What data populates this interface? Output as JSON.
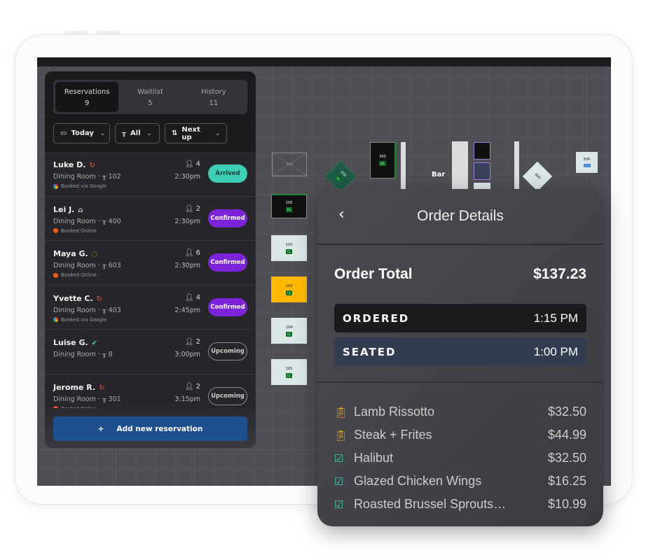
{
  "tabs": [
    {
      "label": "Reservations",
      "count": "9"
    },
    {
      "label": "Waitlist",
      "count": "5"
    },
    {
      "label": "History",
      "count": "11"
    }
  ],
  "filters": {
    "date": "Today",
    "tables": "All",
    "sort": "Next up"
  },
  "reservations": [
    {
      "name": "Luke D.",
      "tag_icon": "sync-icon",
      "area": "Dining Room ·",
      "table": "102",
      "source": "Booked via Google",
      "party": "4",
      "time": "2:30pm",
      "status": "Arrived"
    },
    {
      "name": "Lei J.",
      "tag_icon": "cake-icon",
      "area": "Dining Room ·",
      "table": "400",
      "source": "Booked Online",
      "party": "2",
      "time": "2:30pm",
      "status": "Confirmed"
    },
    {
      "name": "Maya G.",
      "tag_icon": "chat-icon",
      "area": "Dining Room ·",
      "table": "603",
      "source": "Booked Online",
      "party": "6",
      "time": "2:30pm",
      "status": "Confirmed"
    },
    {
      "name": "Yvette C.",
      "tag_icon": "sync-icon",
      "area": "Dining Room ·",
      "table": "403",
      "source": "Booked via Google",
      "party": "4",
      "time": "2:45pm",
      "status": "Confirmed"
    },
    {
      "name": "Luise G.",
      "tag_icon": "check-icon",
      "area": "Dining Room ·",
      "table": "8",
      "source": "",
      "party": "2",
      "time": "3:00pm",
      "status": "Upcoming"
    },
    {
      "name": "Jerome R.",
      "tag_icon": "sync-icon",
      "area": "Dining Room ·",
      "table": "301",
      "source": "Booked Online",
      "party": "2",
      "time": "3:15pm",
      "status": "Upcoming"
    }
  ],
  "add_button": "Add new reservation",
  "floor": {
    "bar": "Bar",
    "tables": {
      "t101": "101",
      "t100": "100",
      "t102": "102",
      "t103": "103",
      "t104": "104",
      "t105": "105",
      "t200": "200",
      "t300": "300",
      "t400": "400",
      "t500": "500"
    },
    "tag": "CL"
  },
  "order": {
    "title": "Order Details",
    "total_label": "Order Total",
    "total": "$137.23",
    "ordered_label": "ORDERED",
    "ordered_time": "1:15 PM",
    "seated_label": "SEATED",
    "seated_time": "1:00 PM",
    "items": [
      {
        "name": "Lamb Rissotto",
        "price": "$32.50",
        "state": "sent"
      },
      {
        "name": "Steak + Frites",
        "price": "$44.99",
        "state": "sent"
      },
      {
        "name": "Halibut",
        "price": "$32.50",
        "state": "done"
      },
      {
        "name": "Glazed Chicken Wings",
        "price": "$16.25",
        "state": "done"
      },
      {
        "name": "Roasted Brussel Sprouts…",
        "price": "$10.99",
        "state": "done"
      }
    ]
  },
  "colors": {
    "arrived": "#3ecdb5",
    "confirmed": "#7b23d9",
    "add_button": "#1f4f8c",
    "seated_bg": "#333d52",
    "ordered_bg": "#1b1b1d",
    "pending_icon": "#f0a818",
    "done_icon": "#3ecdb5"
  }
}
